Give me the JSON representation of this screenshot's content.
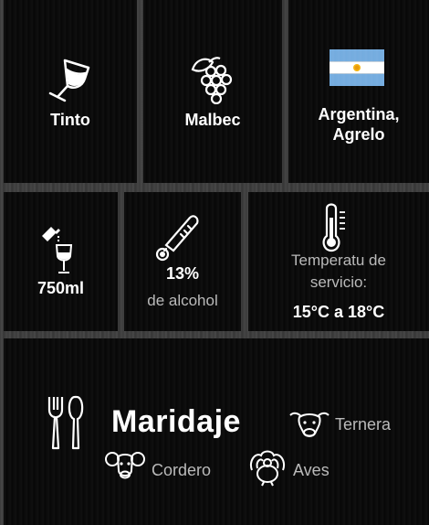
{
  "wine_type": {
    "icon": "wine-glass-icon",
    "label": "Tinto"
  },
  "grape": {
    "icon": "grapes-icon",
    "label": "Malbec"
  },
  "origin": {
    "icon": "argentina-flag-icon",
    "line1": "Argentina,",
    "line2": "Agrelo",
    "flag_colors": {
      "blue": "#74acdf",
      "white": "#ffffff",
      "sun": "#f6b40e"
    }
  },
  "volume": {
    "icon": "pouring-glass-icon",
    "label": "750ml"
  },
  "alcohol": {
    "icon": "thermometer-tube-icon",
    "value": "13%",
    "label": "de alcohol"
  },
  "temperature": {
    "icon": "thermometer-icon",
    "line1": "Temperatu de",
    "line2": "servicio:",
    "value": "15°C a 18°C"
  },
  "pairing": {
    "icon": "fork-spoon-icon",
    "title": "Maridaje",
    "items": [
      {
        "icon": "cow-icon",
        "label": "Ternera"
      },
      {
        "icon": "ram-icon",
        "label": "Cordero"
      },
      {
        "icon": "turkey-icon",
        "label": "Aves"
      }
    ]
  }
}
